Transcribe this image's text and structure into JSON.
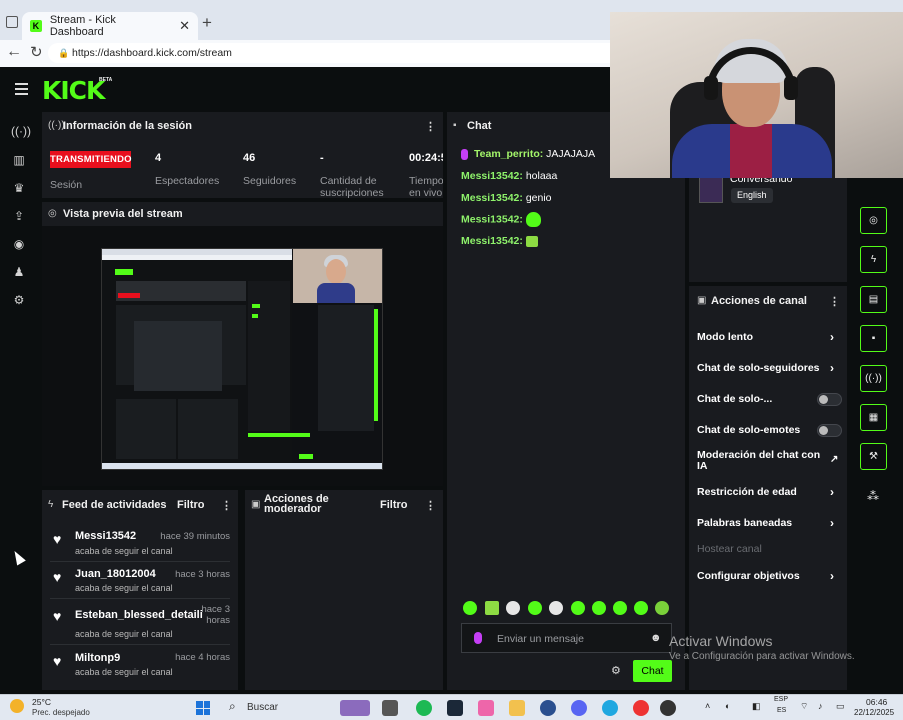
{
  "browser": {
    "tab_title": "Stream - Kick Dashboard",
    "tab_close": "✕",
    "new_tab": "+",
    "url": "https://dashboard.kick.com/stream"
  },
  "header": {
    "logo": "KICK",
    "beta": "BETA"
  },
  "session": {
    "title": "Información de la sesión",
    "badge": "TRANSMITIENDO",
    "badge_label": "Sesión",
    "stats": [
      {
        "value": "4",
        "label": "Espectadores"
      },
      {
        "value": "46",
        "label": "Seguidores"
      },
      {
        "value": "-",
        "label": "Cantidad de suscripciones"
      },
      {
        "value": "00:24:5",
        "label": "Tiempo en vivo"
      }
    ]
  },
  "preview": {
    "title": "Vista previa del stream"
  },
  "activity": {
    "title": "Feed de actividades",
    "filter": "Filtro",
    "items": [
      {
        "name": "Messi13542",
        "time": "hace 39 minutos",
        "desc": "acaba de seguir el canal"
      },
      {
        "name": "Juan_18012004",
        "time": "hace 3 horas",
        "desc": "acaba de seguir el canal"
      },
      {
        "name": "Esteban_blessed_detailing",
        "time": "hace 3 horas",
        "desc": "acaba de seguir el canal"
      },
      {
        "name": "Miltonp9",
        "time": "hace 4 horas",
        "desc": "acaba de seguir el canal"
      }
    ]
  },
  "mod_actions": {
    "title": "Acciones de moderador",
    "filter": "Filtro"
  },
  "chat": {
    "title": "Chat",
    "messages": [
      {
        "user": "Team_perrito:",
        "text": "JAJAJAJA"
      },
      {
        "user": "Messi13542:",
        "text": "holaaa"
      },
      {
        "user": "Messi13542:",
        "text": "genio"
      },
      {
        "user": "Messi13542:",
        "text": ""
      },
      {
        "user": "Messi13542:",
        "text": ""
      }
    ],
    "input_placeholder": "Enviar un mensaje",
    "send_label": "Chat"
  },
  "stream_info": {
    "category": "Conversando",
    "language": "English"
  },
  "channel_actions": {
    "title": "Acciones de canal",
    "items": [
      {
        "label": "Modo lento",
        "control": "chevron"
      },
      {
        "label": "Chat de solo-seguidores",
        "control": "chevron"
      },
      {
        "label": "Chat de solo-...",
        "control": "toggle",
        "enabled": false
      },
      {
        "label": "Chat de solo-emotes",
        "control": "toggle",
        "enabled": false
      },
      {
        "label": "Moderación del chat con IA",
        "control": "external"
      },
      {
        "label": "Restricción de edad",
        "control": "chevron"
      },
      {
        "label": "Palabras baneadas",
        "control": "chevron"
      },
      {
        "label": "Hostear canal",
        "control": "none",
        "disabled": true
      },
      {
        "label": "Configurar objetivos",
        "control": "chevron"
      }
    ]
  },
  "windows": {
    "activate_title": "Activar Windows",
    "activate_sub": "Ve a Configuración para activar Windows.",
    "taskbar": {
      "temp": "25°C",
      "weather": "Prec. despejado",
      "search": "Buscar",
      "lang": "ESP",
      "lang2": "ES",
      "time": "06:46",
      "date": "22/12/2025"
    }
  },
  "colors": {
    "kick_green": "#53fc18",
    "live_red": "#e80f1d",
    "panel_bg": "#191b1f",
    "page_bg": "#0b0e0f"
  }
}
